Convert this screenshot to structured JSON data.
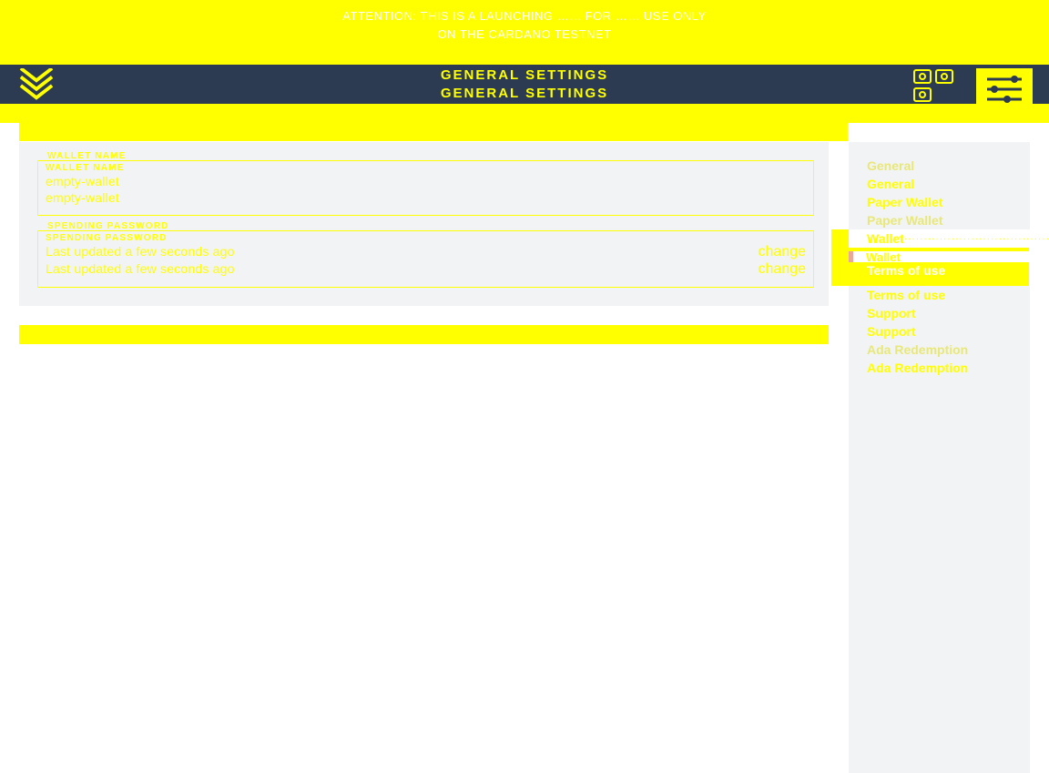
{
  "banner": {
    "line1_leading": "ATTENTION:",
    "line1_rest": " THIS IS A LAUNCHING …… FOR …… USE ONLY",
    "line2": "ON THE CARDANO TESTNET"
  },
  "topbar": {
    "title1": "GENERAL SETTINGS",
    "title2": "GENERAL SETTINGS"
  },
  "card": {
    "walletName": {
      "label": "WALLET NAME",
      "dupLabel": "WALLET NAME",
      "value": "empty-wallet",
      "value2": "empty-wallet"
    },
    "spendingPassword": {
      "label": "SPENDING PASSWORD",
      "dupLabel": "SPENDING PASSWORD",
      "updated1": "Last updated a few seconds ago",
      "updated2": "Last updated a few seconds ago",
      "change1": "change",
      "change2": "change"
    }
  },
  "sidebar": {
    "items": [
      "General",
      "General",
      "Paper Wallet",
      "Paper Wallet"
    ],
    "overlay": {
      "wallet1": "Wallet",
      "wallet2": "Wallet",
      "dots": "········································",
      "terms": "Terms of use"
    },
    "itemsBottom": [
      "Terms of use",
      "Support",
      "Support",
      "Ada Redemption",
      "Ada Redemption"
    ]
  }
}
